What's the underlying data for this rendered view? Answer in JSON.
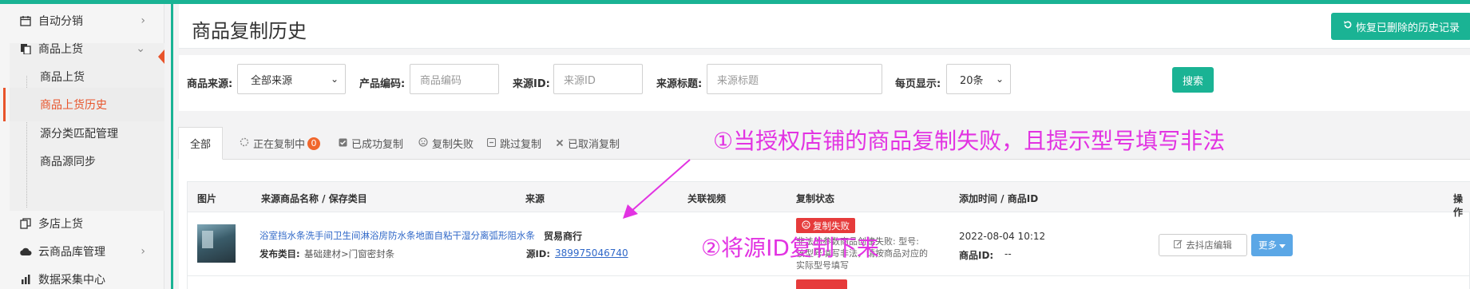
{
  "sidebar": {
    "items": [
      {
        "label": "自动分销",
        "icon": "calendar-icon",
        "arrow": "›"
      },
      {
        "label": "商品上货",
        "icon": "copy-doc-icon",
        "arrow": "⌄"
      },
      {
        "label": "多店上货",
        "icon": "copy-icon",
        "arrow": ""
      },
      {
        "label": "云商品库管理",
        "icon": "cloud-icon",
        "arrow": "›"
      },
      {
        "label": "数据采集中心",
        "icon": "data-icon",
        "arrow": ""
      }
    ],
    "sub_items": [
      {
        "label": "商品上货"
      },
      {
        "label": "商品上货历史"
      },
      {
        "label": "源分类匹配管理"
      },
      {
        "label": "商品源同步"
      }
    ]
  },
  "header": {
    "title": "商品复制历史",
    "restore_label": "恢复已删除的历史记录"
  },
  "filter": {
    "source_label": "商品来源:",
    "source_value": "全部来源",
    "code_label": "产品编码:",
    "code_placeholder": "商品编码",
    "srcid_label": "来源ID:",
    "srcid_placeholder": "来源ID",
    "srctitle_label": "来源标题:",
    "srctitle_placeholder": "来源标题",
    "perpage_label": "每页显示:",
    "perpage_value": "20条",
    "search_label": "搜索"
  },
  "tabs": [
    {
      "label": "全部",
      "icon": ""
    },
    {
      "label": "正在复制中",
      "icon": "spinner-icon",
      "badge": "0"
    },
    {
      "label": "已成功复制",
      "icon": "check-square-icon"
    },
    {
      "label": "复制失败",
      "icon": "frown-icon"
    },
    {
      "label": "跳过复制",
      "icon": "minus-square-icon"
    },
    {
      "label": "已取消复制",
      "icon": "x-icon"
    }
  ],
  "table": {
    "headers": [
      "图片",
      "来源商品名称 / 保存类目",
      "来源",
      "关联视频",
      "复制状态",
      "添加时间 / 商品ID",
      "操作"
    ],
    "rows": [
      {
        "product_name": "浴室挡水条洗手间卫生间淋浴房防水条地面自粘干湿分离弧形阻水条",
        "category_label": "发布类目:",
        "category": "基础建材>门窗密封条",
        "source_name": "贸易商行",
        "source_id_label": "源ID:",
        "source_id": "389975046740",
        "status": "复制失败",
        "status_message": "非法的参数商品创建失败: 型号: 该型号填写非法，请按商品对应的实际型号填写",
        "time": "2022-08-04 10:12",
        "product_id_label": "商品ID:",
        "product_id": "--",
        "edit_label": "去抖店编辑",
        "more_label": "更多"
      }
    ]
  },
  "annotations": {
    "note1": "①当授权店铺的商品复制失败，且提示型号填写非法",
    "note2": "②将源ID复制下来"
  },
  "colors": {
    "accent": "#1ab394",
    "annotation": "#e233e2",
    "error": "#e63b3b",
    "link": "#3068c8",
    "active_menu": "#e8542b"
  }
}
